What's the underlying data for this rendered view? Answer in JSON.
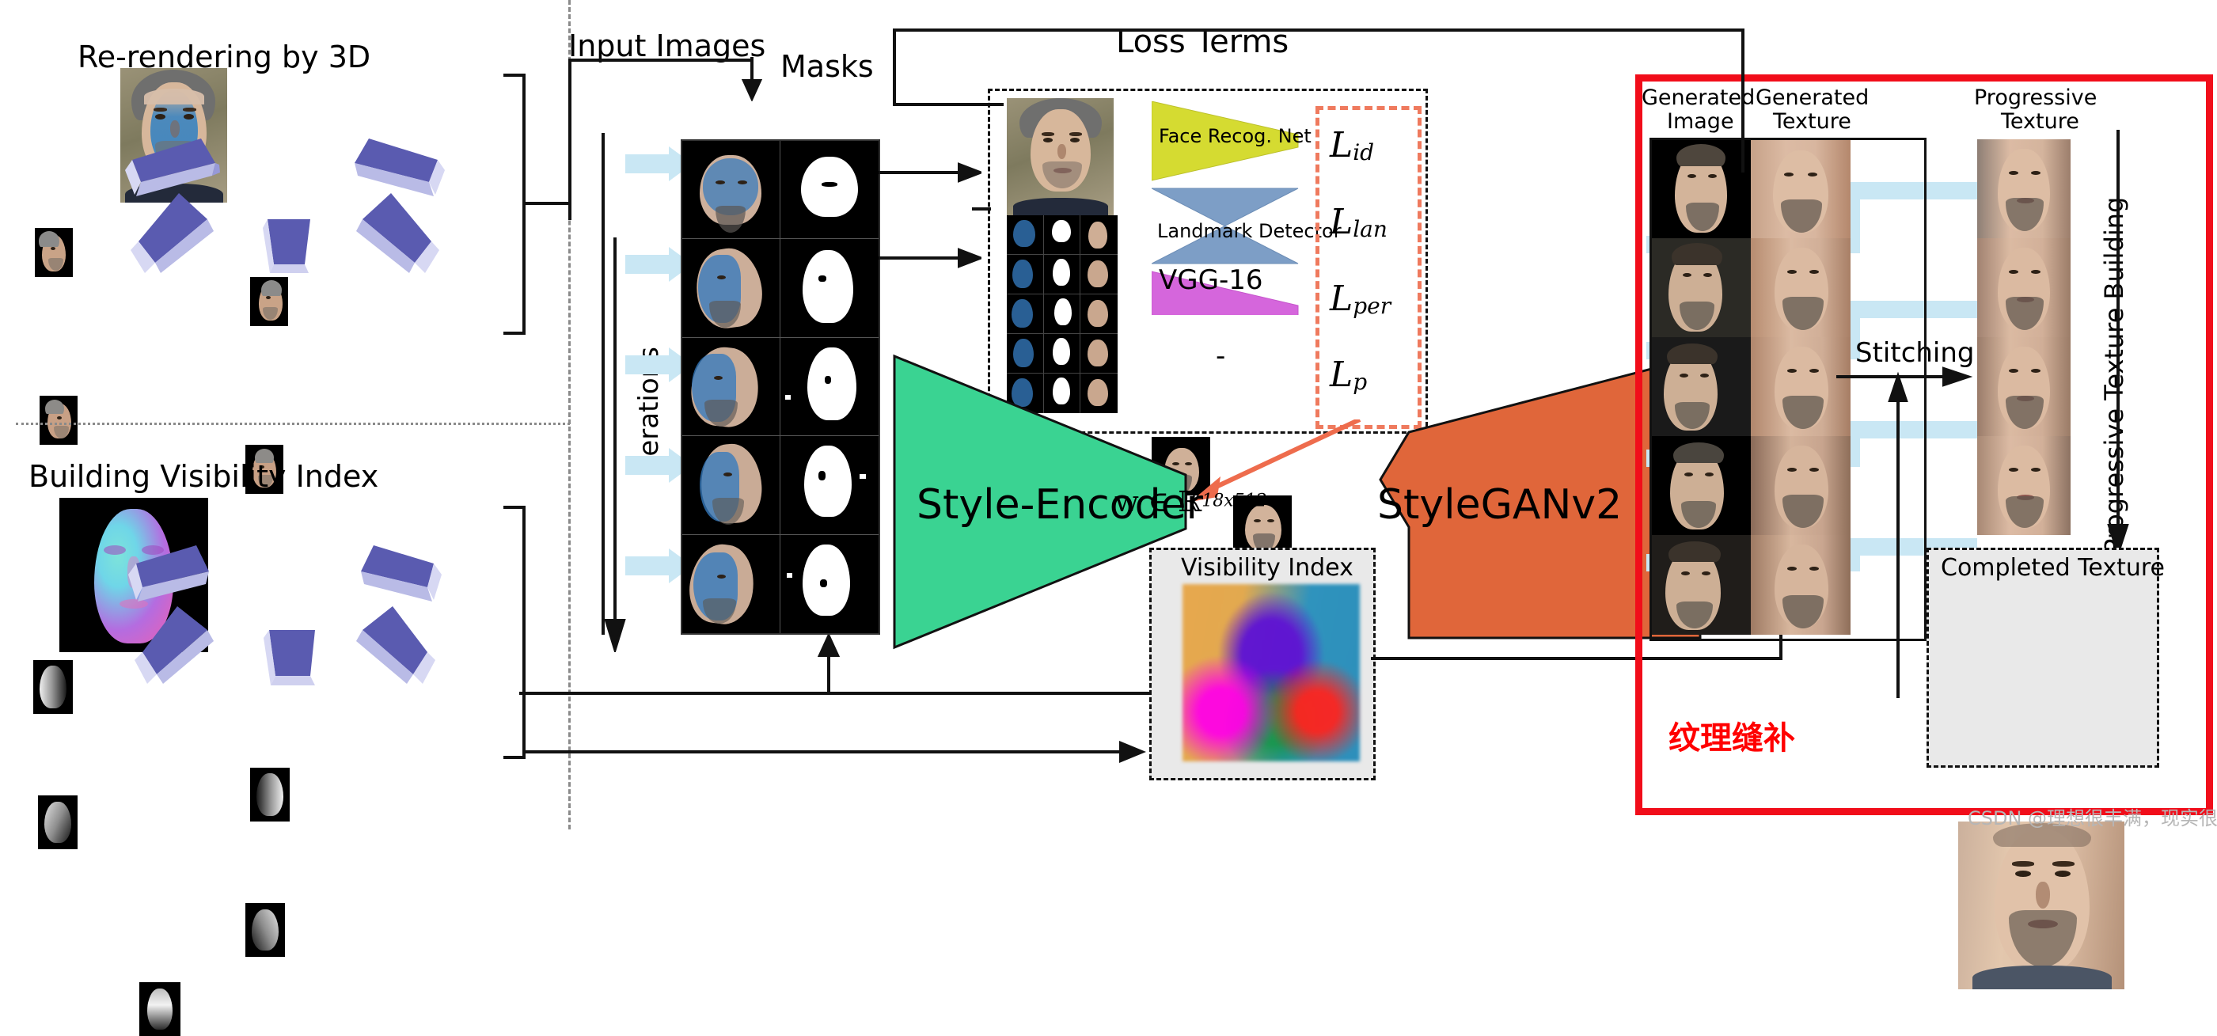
{
  "figure": {
    "type": "pipeline-diagram",
    "title_left_top": "Re-rendering by 3D",
    "title_left_bottom": "Building Visibility Index",
    "label_input_images": "Input Images",
    "label_masks": "Masks",
    "label_iterations": "Iterations",
    "label_loss_terms": "Loss Terms",
    "label_style_encoder": "Style-Encoder",
    "label_w_space": "w ∈ ℝ",
    "label_w_space_sup": "18x512",
    "label_stylegan": "StyleGANv2",
    "label_visibility_index": "Visibility Index",
    "label_stitching": "Stitching",
    "label_generated_image": "Generated\nImage",
    "label_generated_image_l1": "Generated",
    "label_generated_image_l2": "Image",
    "label_generated_texture_l1": "Generated",
    "label_generated_texture_l2": "Texture",
    "label_progressive_texture_l1": "Progressive",
    "label_progressive_texture_l2": "Texture",
    "label_progressive_texture_building": "Progressive Texture Building",
    "label_completed_texture": "Completed Texture",
    "label_annotation_cn": "纹理缝补",
    "watermark": "CSDN @理想很丰满，现实很骨感"
  },
  "loss_networks": [
    {
      "name": "Face Recog. Net",
      "color": "#d5db31",
      "shape": "trapezoid-right"
    },
    {
      "name": "Landmark Detector",
      "color": "#7d9ec6",
      "shape": "bowtie"
    },
    {
      "name": "VGG-16",
      "color": "#d566dc",
      "shape": "trapezoid-right"
    }
  ],
  "loss_terms": [
    {
      "symbol": "L",
      "subscript": "id"
    },
    {
      "symbol": "L",
      "subscript": "lan"
    },
    {
      "symbol": "L",
      "subscript": "per"
    },
    {
      "symbol": "L",
      "subscript": "p"
    }
  ],
  "colors": {
    "style_encoder": "#3ad392",
    "stylegan": "#e0663a",
    "red_box": "#f10d1a",
    "annotation_cn": "#ff0000",
    "flow_arrow": "#c9e7f4",
    "loss_dash": "#ef7a5e",
    "frustum_dark": "#5a5bb0",
    "frustum_light": "#b9bbe6"
  },
  "counts": {
    "rerender_views": 5,
    "visibility_views": 5,
    "mask_rows": 5,
    "mask_cols": 2,
    "loss_grid_rows": 5,
    "loss_grid_cols": 3,
    "generated_rows": 5,
    "progressive_rows": 4
  }
}
